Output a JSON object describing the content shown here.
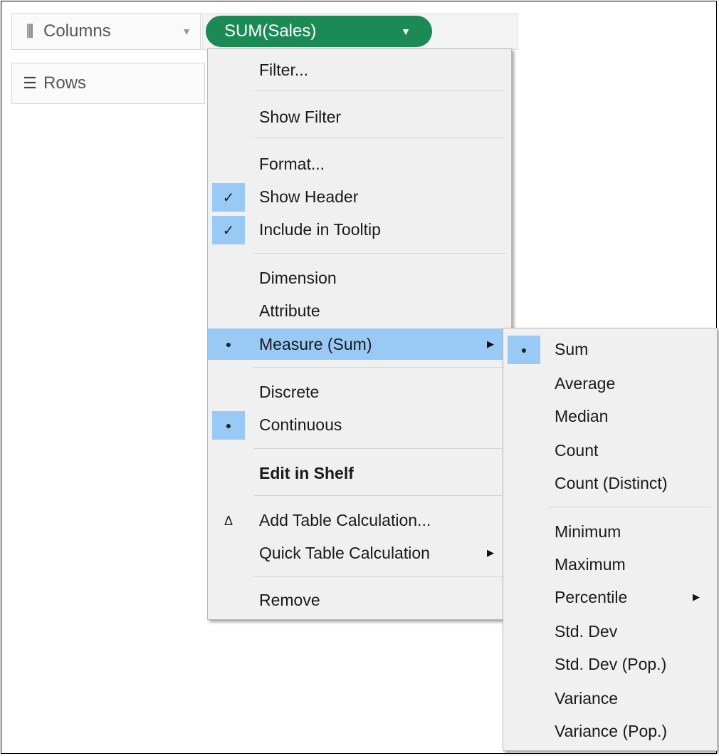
{
  "shelves": {
    "columns_label": "Columns",
    "rows_label": "Rows",
    "columns_icon": "columns-icon",
    "rows_icon": "rows-icon"
  },
  "pill": {
    "label": "SUM(Sales)",
    "color": "#1b8a54"
  },
  "context_menu": {
    "filter": "Filter...",
    "show_filter": "Show Filter",
    "format": "Format...",
    "show_header": "Show Header",
    "include_in_tooltip": "Include in Tooltip",
    "dimension": "Dimension",
    "attribute": "Attribute",
    "measure_sum": "Measure (Sum)",
    "discrete": "Discrete",
    "continuous": "Continuous",
    "edit_in_shelf": "Edit in Shelf",
    "add_table_calculation": "Add Table Calculation...",
    "quick_table_calculation": "Quick Table Calculation",
    "remove": "Remove",
    "check_glyph": "✓",
    "bullet_glyph": "●",
    "delta_glyph": "Δ",
    "submenu_arrow": "▶"
  },
  "measure_submenu": {
    "sum": "Sum",
    "average": "Average",
    "median": "Median",
    "count": "Count",
    "count_distinct": "Count (Distinct)",
    "minimum": "Minimum",
    "maximum": "Maximum",
    "percentile": "Percentile",
    "std_dev": "Std. Dev",
    "std_dev_pop": "Std. Dev (Pop.)",
    "variance": "Variance",
    "variance_pop": "Variance (Pop.)"
  },
  "colors": {
    "highlight": "#99c9f5",
    "menu_bg": "#f0f0f0"
  }
}
